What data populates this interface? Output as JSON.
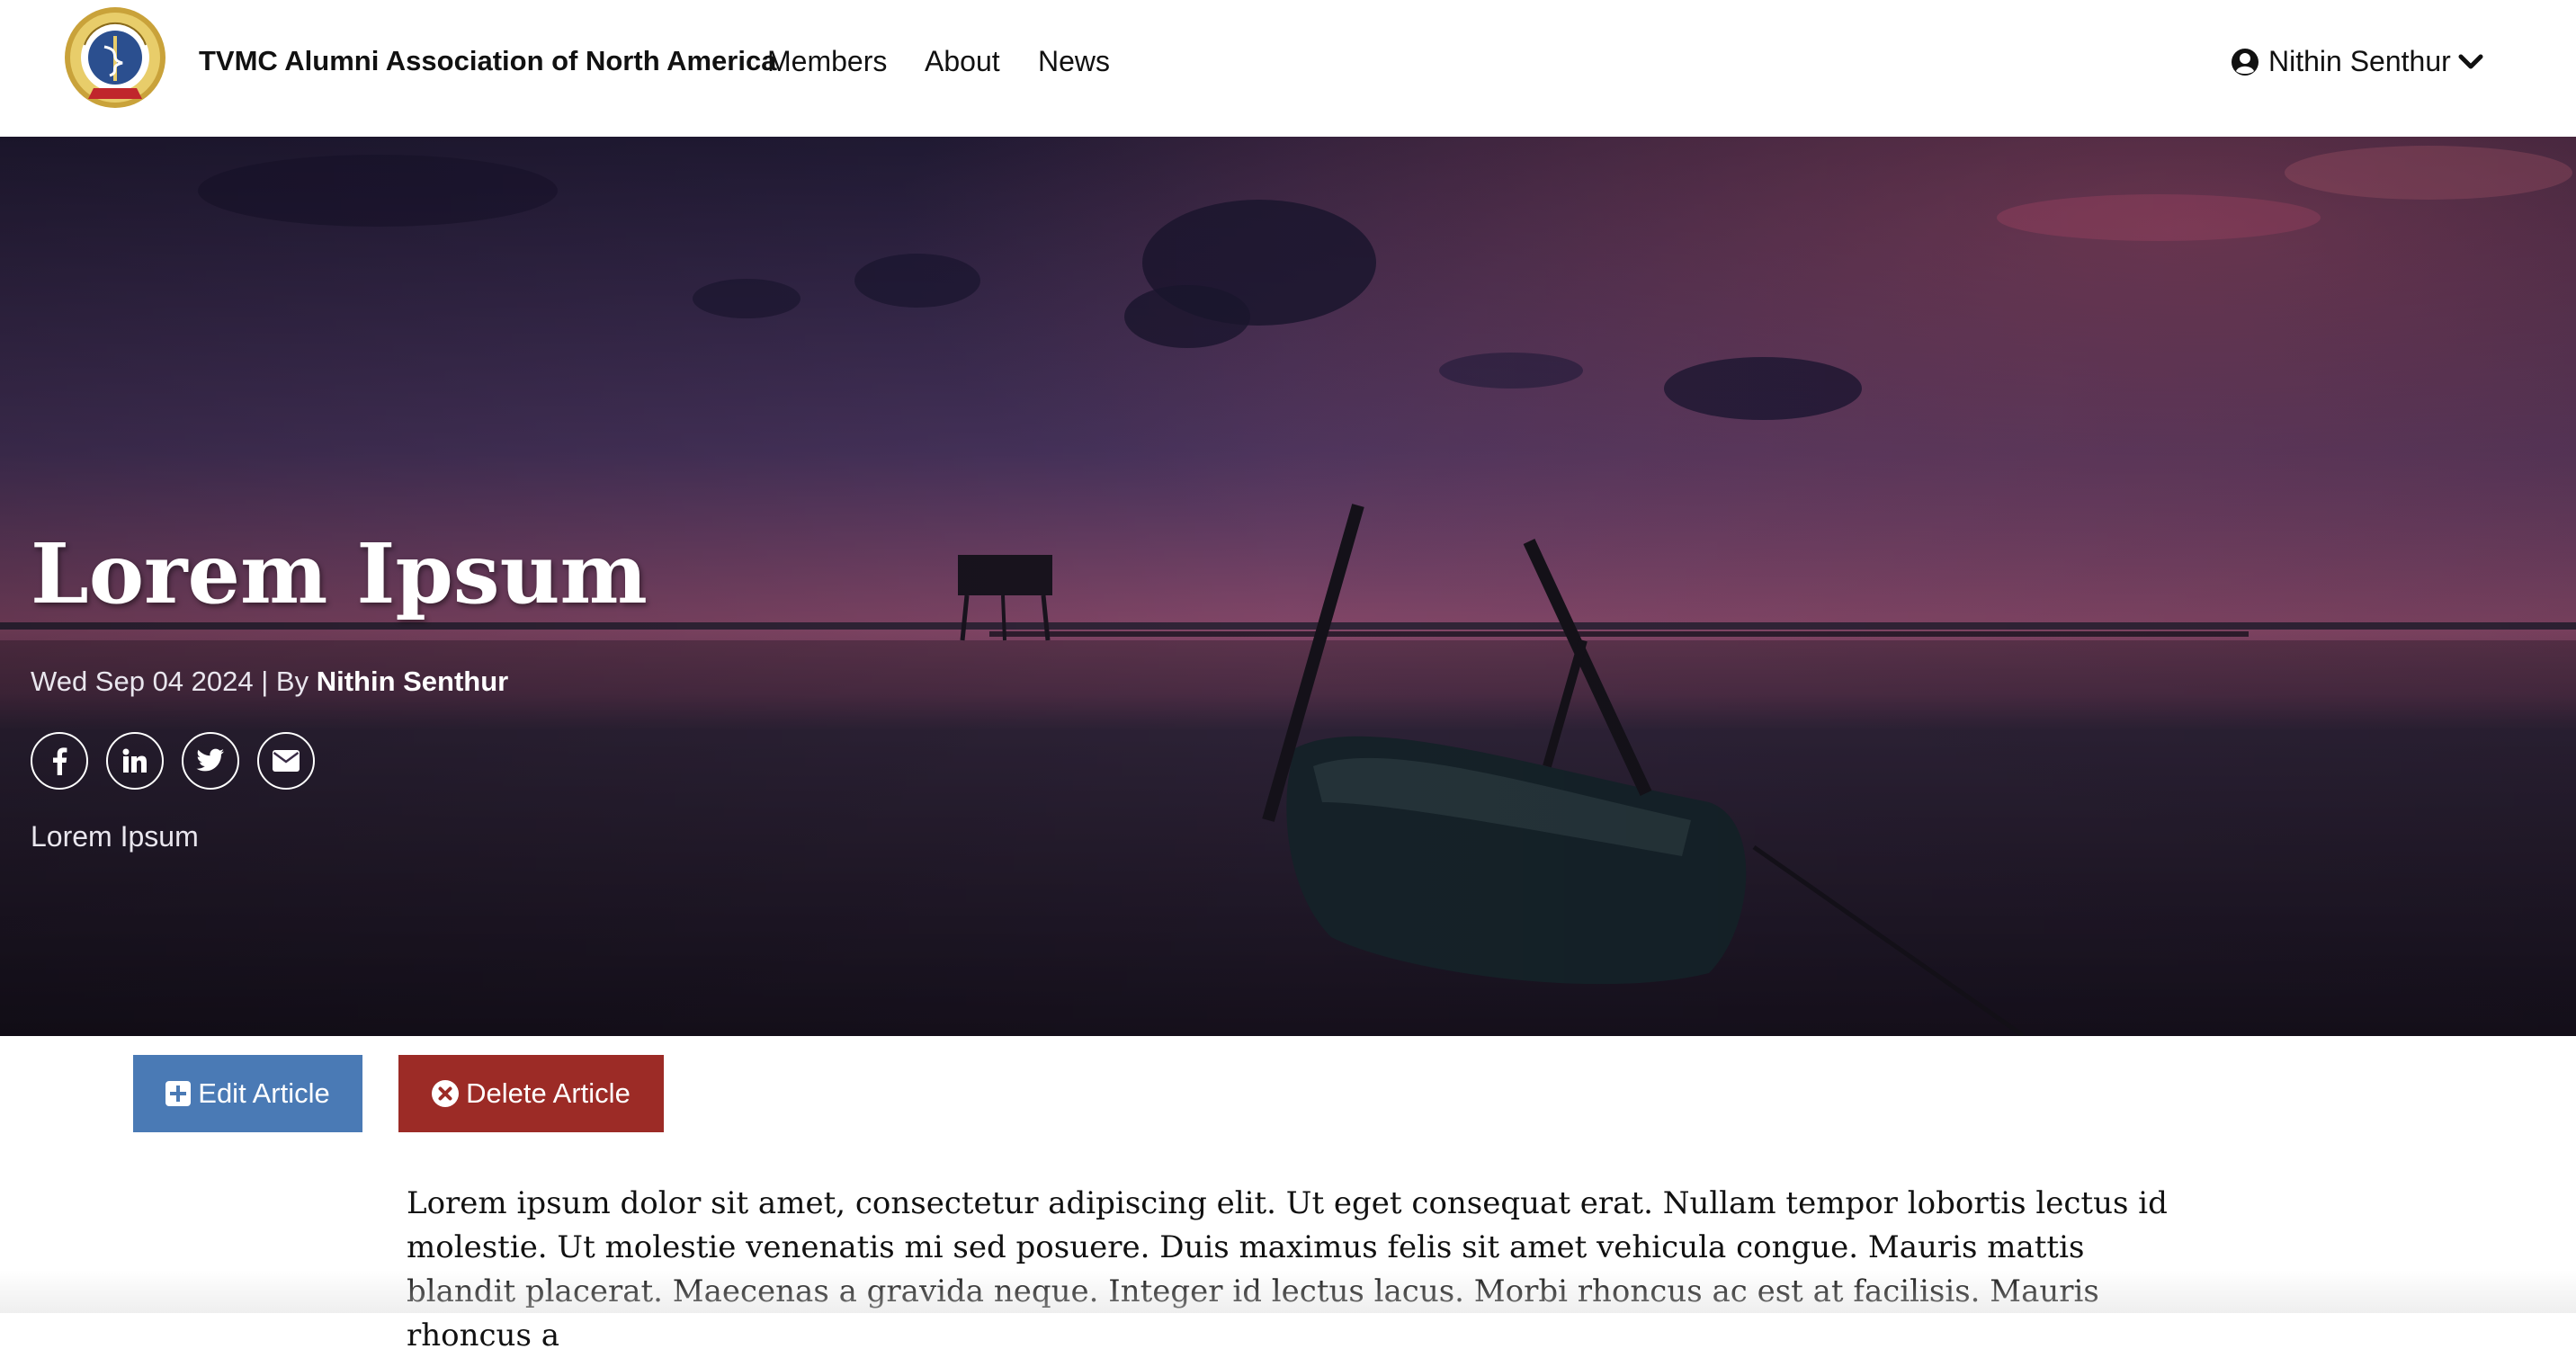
{
  "navbar": {
    "brand": "TVMC Alumni Association of North America",
    "logo_icon": "tvmc-alumni-seal-icon",
    "links": [
      "Members",
      "About",
      "News"
    ],
    "user_name": "Nithin Senthur",
    "user_icon": "user-circle-icon",
    "dropdown_icon": "chevron-down-icon"
  },
  "article": {
    "title": "Lorem Ipsum",
    "date": "Wed Sep 04 2024",
    "separator": " | By ",
    "author": "Nithin Senthur",
    "subtitle": "Lorem Ipsum",
    "share_icons": [
      "facebook-icon",
      "linkedin-icon",
      "twitter-icon",
      "envelope-icon"
    ],
    "body": "Lorem ipsum dolor sit amet, consectetur adipiscing elit. Ut eget consequat erat. Nullam tempor lobortis lectus id molestie. Ut molestie venenatis mi sed posuere. Duis maximus felis sit amet vehicula congue. Mauris mattis blandit placerat. Maecenas a gravida neque. Integer id lectus lacus. Morbi rhoncus ac est at facilisis. Mauris rhoncus a"
  },
  "actions": {
    "edit_label": "Edit Article",
    "delete_label": "Delete Article",
    "edit_color": "#4a7ab5",
    "delete_color": "#9c2b26"
  },
  "colors": {
    "hero_sky_top": "#2a2240",
    "hero_sunset": "#8a4a6c",
    "text_dark": "#111111"
  }
}
